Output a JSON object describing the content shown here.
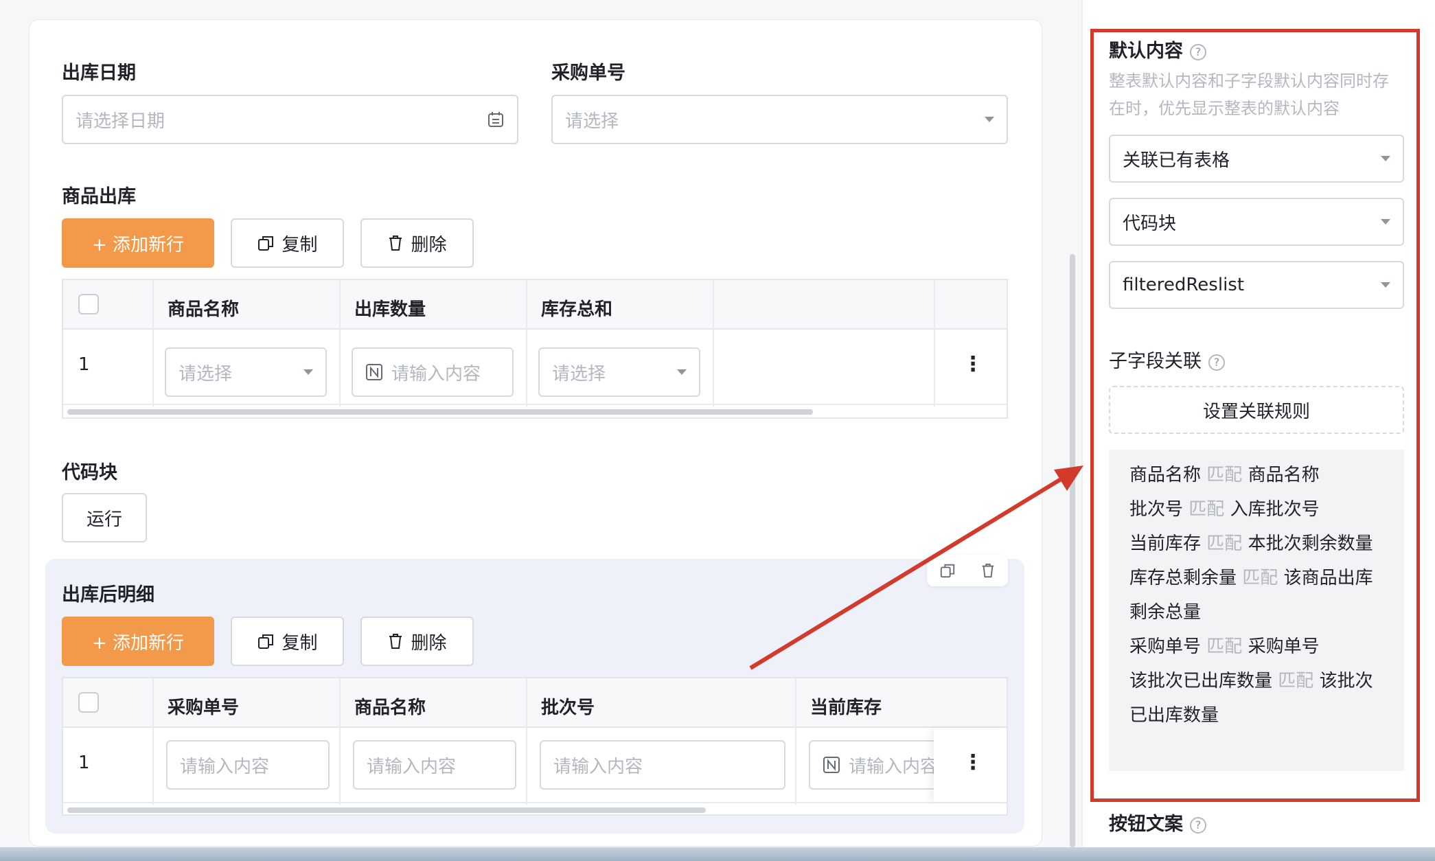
{
  "form": {
    "date_label": "出库日期",
    "date_placeholder": "请选择日期",
    "po_label": "采购单号",
    "po_placeholder": "请选择",
    "goods_section": "商品出库",
    "add_row": "+ 添加新行",
    "copy": "复制",
    "delete": "删除",
    "table1": {
      "headers": [
        "商品名称",
        "出库数量",
        "库存总和"
      ],
      "row_index": "1",
      "cells": [
        "请选择",
        "请输入内容",
        "请选择"
      ]
    },
    "code_section": "代码块",
    "run_button": "运行",
    "detail_section": "出库后明细",
    "table2": {
      "headers": [
        "采购单号",
        "商品名称",
        "批次号",
        "当前库存"
      ],
      "row_index": "1",
      "cells": [
        "请输入内容",
        "请输入内容",
        "请输入内容",
        "请输入内容"
      ]
    }
  },
  "panel": {
    "default_title": "默认内容",
    "default_desc": "整表默认内容和子字段默认内容同时存在时，优先显示整表的默认内容",
    "select1": "关联已有表格",
    "select2": "代码块",
    "select3": "filteredReslist",
    "sub_title": "子字段关联",
    "set_rule": "设置关联规则",
    "match_word": "匹配",
    "rules": [
      {
        "from": "商品名称",
        "to": "商品名称"
      },
      {
        "from": "批次号",
        "to": "入库批次号"
      },
      {
        "from": "当前库存",
        "to": "本批次剩余数量"
      },
      {
        "from": "库存总剩余量",
        "to": "该商品出库剩余总量"
      },
      {
        "from": "采购单号",
        "to": "采购单号"
      },
      {
        "from": "该批次已出库数量",
        "to": "该批次已出库数量"
      }
    ],
    "button_text_title": "按钮文案"
  },
  "colors": {
    "accent": "#f2994a",
    "annotation": "#d23b2c"
  }
}
